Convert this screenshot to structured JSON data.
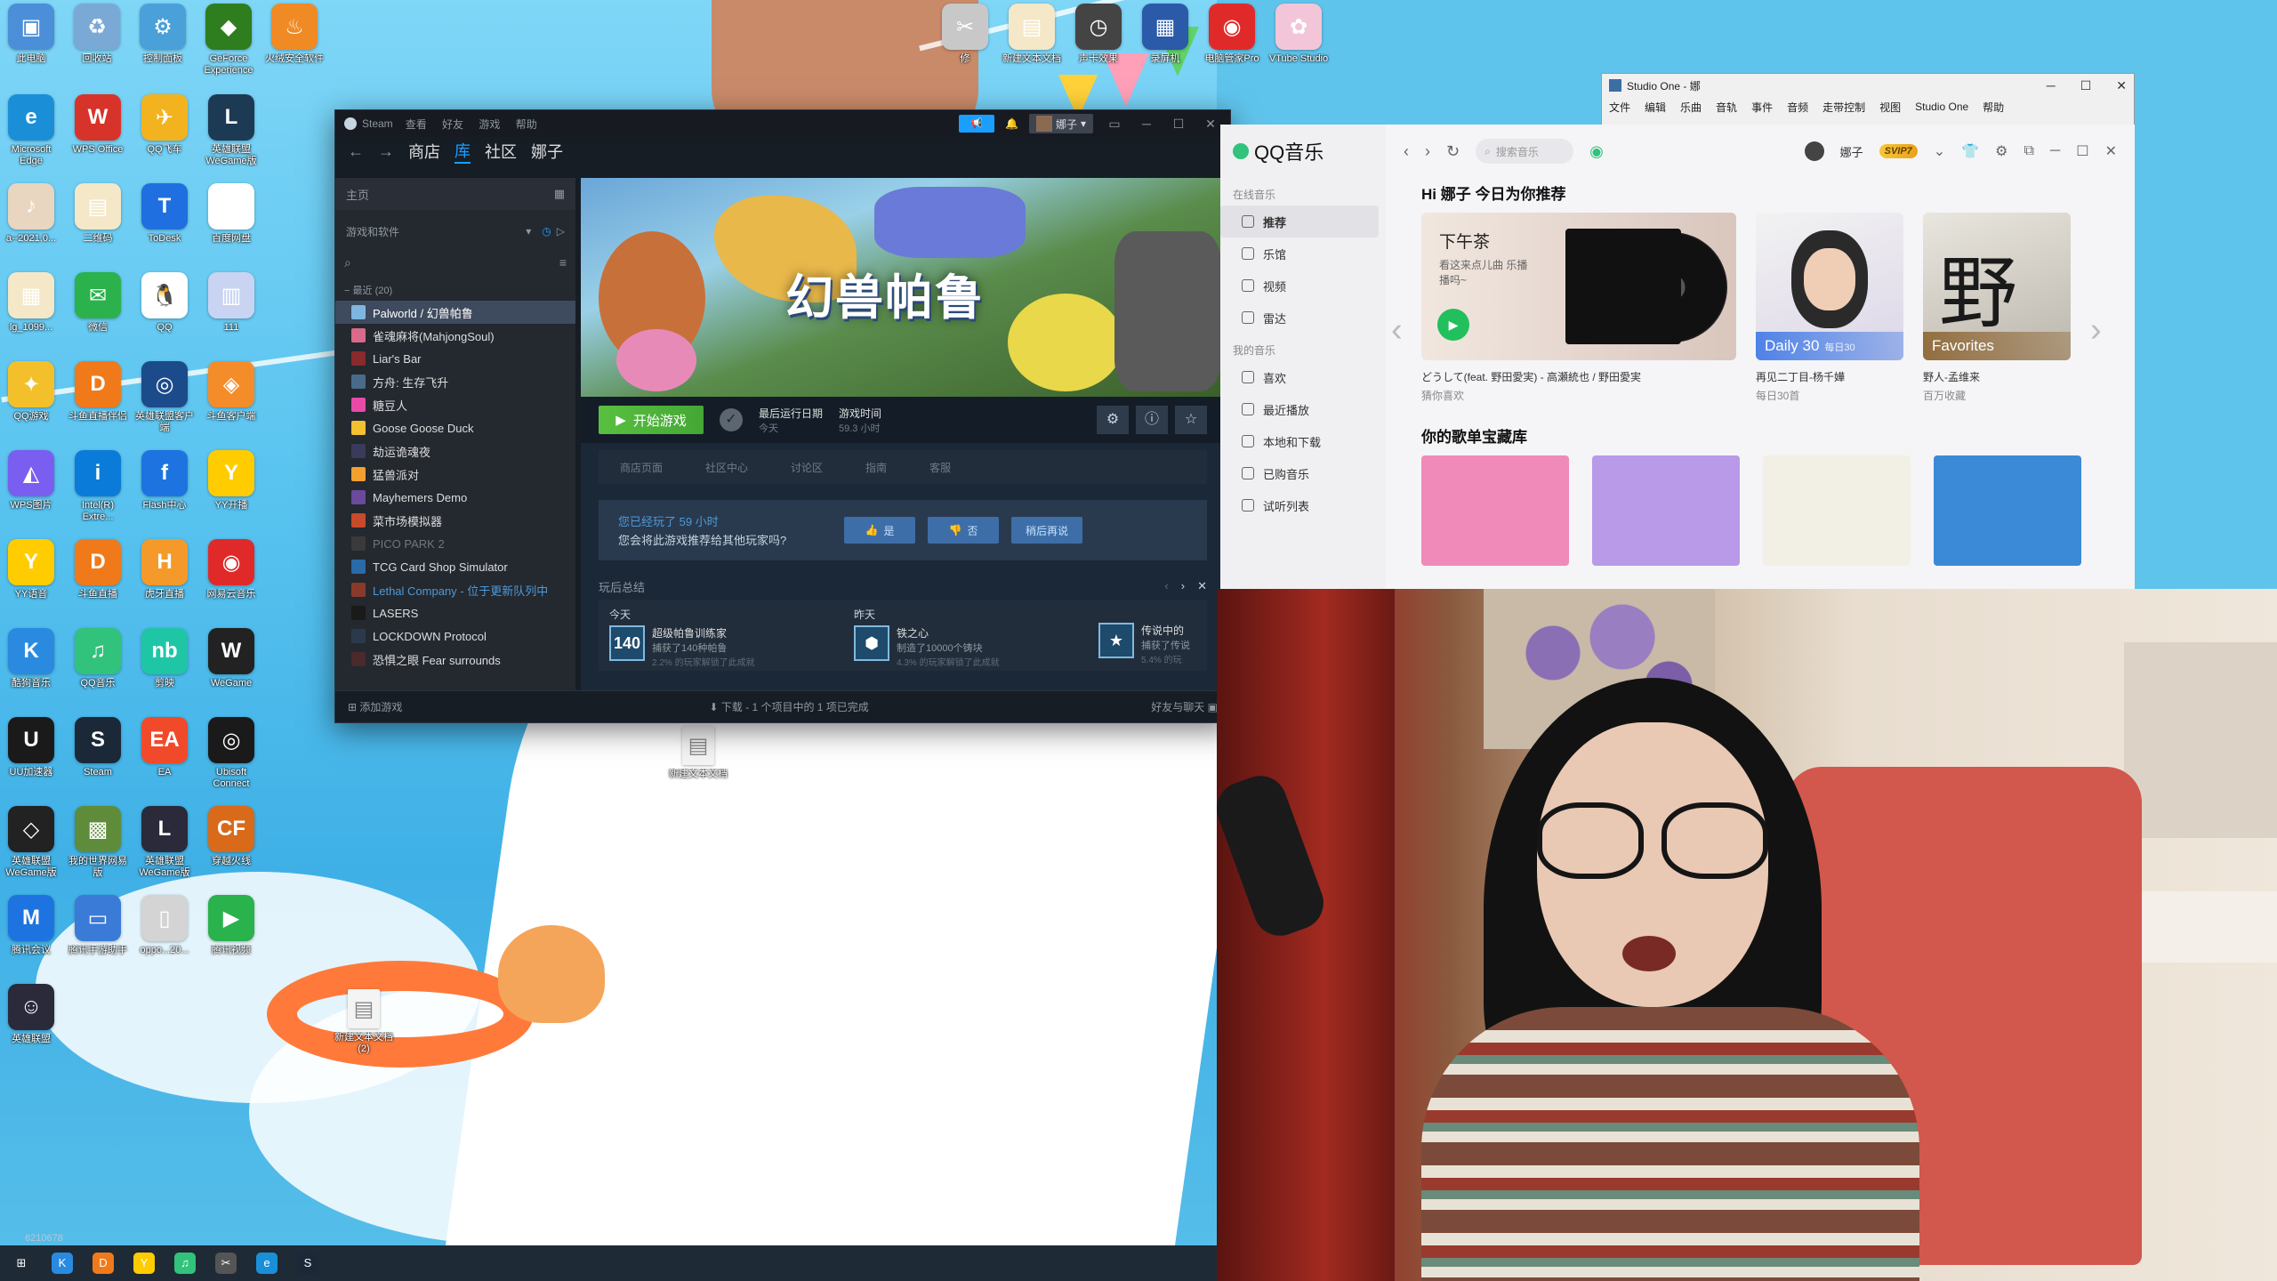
{
  "desktop": {
    "icons": [
      {
        "label": "此电脑",
        "color": "#4a8fd8",
        "glyph": "▣"
      },
      {
        "label": "回收站",
        "color": "#7aa9d6",
        "glyph": "♻"
      },
      {
        "label": "控制面板",
        "color": "#4aa0d8",
        "glyph": "⚙"
      },
      {
        "label": "GeForce Experience",
        "color": "#2e7d1e",
        "glyph": "◆"
      },
      {
        "label": "火绒安全软件",
        "color": "#f08a24",
        "glyph": "♨"
      },
      {
        "label": "Microsoft Edge",
        "color": "#1a8fd8",
        "glyph": "e"
      },
      {
        "label": "WPS Office",
        "color": "#d8332a",
        "glyph": "W"
      },
      {
        "label": "QQ飞车",
        "color": "#f2b31f",
        "glyph": "✈"
      },
      {
        "label": "英雄联盟WeGame版",
        "color": "#1d3a55",
        "glyph": "L"
      },
      {
        "label": "a--2021.0...",
        "color": "#e8d6c0",
        "glyph": "♪"
      },
      {
        "label": "二维码",
        "color": "#f4e8c8",
        "glyph": "▤"
      },
      {
        "label": "ToDesk",
        "color": "#1f6fe0",
        "glyph": "T"
      },
      {
        "label": "百度网盘",
        "color": "#ffffff",
        "glyph": "☁"
      },
      {
        "label": "lg_1099...",
        "color": "#f4e8c8",
        "glyph": "▦"
      },
      {
        "label": "微信",
        "color": "#2bb24c",
        "glyph": "✉"
      },
      {
        "label": "QQ",
        "color": "#ffffff",
        "glyph": "🐧"
      },
      {
        "label": "111",
        "color": "#c9d4f2",
        "glyph": "▥"
      },
      {
        "label": "QQ游戏",
        "color": "#f3c02c",
        "glyph": "✦"
      },
      {
        "label": "斗鱼直播伴侣",
        "color": "#f07a1a",
        "glyph": "D"
      },
      {
        "label": "英雄联盟客户端",
        "color": "#1b4b8a",
        "glyph": "◎"
      },
      {
        "label": "斗鱼客户端",
        "color": "#f48c2a",
        "glyph": "◈"
      },
      {
        "label": "WPS图片",
        "color": "#7a5ef0",
        "glyph": "◭"
      },
      {
        "label": "Intel(R) Extre...",
        "color": "#0a7bd8",
        "glyph": "i"
      },
      {
        "label": "Flash中心",
        "color": "#1d74e0",
        "glyph": "f"
      },
      {
        "label": "YY开播",
        "color": "#ffcc00",
        "glyph": "Y"
      },
      {
        "label": "YY语音",
        "color": "#ffcc00",
        "glyph": "Y"
      },
      {
        "label": "斗鱼直播",
        "color": "#f07a1a",
        "glyph": "D"
      },
      {
        "label": "虎牙直播",
        "color": "#f59a2a",
        "glyph": "H"
      },
      {
        "label": "网易云音乐",
        "color": "#e02a2a",
        "glyph": "◉"
      },
      {
        "label": "酷狗音乐",
        "color": "#2a8ae0",
        "glyph": "K"
      },
      {
        "label": "QQ音乐",
        "color": "#31c27c",
        "glyph": "♫"
      },
      {
        "label": "剪映",
        "color": "#1fc6a6",
        "glyph": "nb"
      },
      {
        "label": "WeGame",
        "color": "#222",
        "glyph": "W"
      },
      {
        "label": "UU加速器",
        "color": "#1a1a1a",
        "glyph": "U"
      },
      {
        "label": "Steam",
        "color": "#1b2838",
        "glyph": "S"
      },
      {
        "label": "EA",
        "color": "#f14a2a",
        "glyph": "EA"
      },
      {
        "label": "Ubisoft Connect",
        "color": "#1a1a1a",
        "glyph": "◎"
      },
      {
        "label": "英雄联盟WeGame版",
        "color": "#222",
        "glyph": "◇"
      },
      {
        "label": "我的世界网易版",
        "color": "#5e8c3a",
        "glyph": "▩"
      },
      {
        "label": "英雄联盟WeGame版",
        "color": "#2a2a3a",
        "glyph": "L"
      },
      {
        "label": "穿越火线",
        "color": "#d86a1a",
        "glyph": "CF"
      },
      {
        "label": "腾讯会议",
        "color": "#1d74e0",
        "glyph": "M"
      },
      {
        "label": "腾讯手游助手",
        "color": "#3b7bd8",
        "glyph": "▭"
      },
      {
        "label": "oppo...20...",
        "color": "#d4d4d4",
        "glyph": "▯"
      },
      {
        "label": "腾讯视频",
        "color": "#2ab24c",
        "glyph": "▶"
      },
      {
        "label": "英雄联盟",
        "color": "#2a2a3a",
        "glyph": "☺"
      }
    ],
    "top_icons": [
      {
        "label": "修",
        "color": "#c8c8c8",
        "glyph": "✂"
      },
      {
        "label": "新建文本文档",
        "color": "#f4e8c8",
        "glyph": "▤"
      },
      {
        "label": "声卡效果",
        "color": "#444",
        "glyph": "◷"
      },
      {
        "label": "录屏机",
        "color": "#2a5aa8",
        "glyph": "▦"
      },
      {
        "label": "电脑管家Pro",
        "color": "#e02a2a",
        "glyph": "◉"
      },
      {
        "label": "VTube Studio",
        "color": "#f2c6d8",
        "glyph": "✿"
      }
    ],
    "floating_files": [
      {
        "label": "新建文本文档"
      },
      {
        "label": "新建文本文档(2)"
      }
    ]
  },
  "steam": {
    "app": "Steam",
    "menu": [
      "查看",
      "好友",
      "游戏",
      "帮助"
    ],
    "announce_btn": "📢",
    "bell": "🔔",
    "user": "娜子",
    "nav": {
      "store": "商店",
      "library": "库",
      "community": "社区",
      "profile": "娜子"
    },
    "sidebar": {
      "home": "主页",
      "filter": "游戏和软件",
      "section": "最近",
      "section_count": "(20)",
      "games": [
        {
          "name": "Palworld / 幻兽帕鲁",
          "state": "selected",
          "color": "#7fb6e0"
        },
        {
          "name": "雀魂麻将(MahjongSoul)",
          "state": "",
          "color": "#d86a8a"
        },
        {
          "name": "Liar's Bar",
          "state": "",
          "color": "#8a2a2a"
        },
        {
          "name": "方舟: 生存飞升",
          "state": "",
          "color": "#4a6a8a"
        },
        {
          "name": "糖豆人",
          "state": "",
          "color": "#e84aa8"
        },
        {
          "name": "Goose Goose Duck",
          "state": "",
          "color": "#f2c030"
        },
        {
          "name": "劫运诡魂夜",
          "state": "",
          "color": "#3a3a5a"
        },
        {
          "name": "猛兽派对",
          "state": "",
          "color": "#f2a030"
        },
        {
          "name": "Mayhemers Demo",
          "state": "",
          "color": "#6a4a9a"
        },
        {
          "name": "菜市场模拟器",
          "state": "",
          "color": "#c84a2a"
        },
        {
          "name": "PICO PARK 2",
          "state": "dim",
          "color": "#3a3a3a"
        },
        {
          "name": "TCG Card Shop Simulator",
          "state": "",
          "color": "#2a6aa8"
        },
        {
          "name": "Lethal Company - 位于更新队列中",
          "state": "update",
          "color": "#8a3a2a"
        },
        {
          "name": "LASERS",
          "state": "",
          "color": "#1a1a1a"
        },
        {
          "name": "LOCKDOWN Protocol",
          "state": "",
          "color": "#2a3a4a"
        },
        {
          "name": "恐惧之眼 Fear surrounds",
          "state": "",
          "color": "#4a2a2a"
        }
      ]
    },
    "game": {
      "hero_title": "幻兽帕鲁",
      "play": "开始游戏",
      "last_played_label": "最后运行日期",
      "last_played_value": "今天",
      "playtime_label": "游戏时间",
      "playtime_value": "59.3 小时",
      "subnav": [
        "商店页面",
        "社区中心",
        "讨论区",
        "指南",
        "客服"
      ],
      "review_played": "您已经玩了 59 小时",
      "review_question": "您会将此游戏推荐给其他玩家吗?",
      "review_yes": "是",
      "review_no": "否",
      "review_later": "稍后再说",
      "recap_title": "玩后总结",
      "recap": [
        {
          "day": "今天",
          "badge": "140",
          "name": "超级帕鲁训练家",
          "desc": "捕获了140种帕鲁",
          "pct": "2.2% 的玩家解锁了此成就"
        },
        {
          "day": "昨天",
          "badge": "⬢",
          "name": "铁之心",
          "desc": "制造了10000个铸块",
          "pct": "4.3% 的玩家解锁了此成就"
        },
        {
          "day": "",
          "badge": "★",
          "name": "传说中的",
          "desc": "捕获了传说",
          "pct": "5.4% 的玩"
        }
      ]
    },
    "status": {
      "add_game": "添加游戏",
      "download": "下载 - 1 个项目中的 1 项已完成",
      "friends": "好友与聊天"
    }
  },
  "studio_one": {
    "title": "Studio One - 娜",
    "menu": [
      "文件",
      "编辑",
      "乐曲",
      "音轨",
      "事件",
      "音频",
      "走带控制",
      "视图",
      "Studio One",
      "帮助"
    ]
  },
  "qqmusic": {
    "brand": "QQ音乐",
    "search_placeholder": "搜索音乐",
    "user": "娜子",
    "vip": "SVIP7",
    "sidebar": {
      "section1": "在线音乐",
      "online": [
        {
          "label": "推荐",
          "active": true
        },
        {
          "label": "乐馆",
          "active": false
        },
        {
          "label": "视频",
          "active": false
        },
        {
          "label": "雷达",
          "active": false
        }
      ],
      "section2": "我的音乐",
      "mine": [
        "喜欢",
        "最近播放",
        "本地和下载",
        "已购音乐",
        "试听列表"
      ]
    },
    "recommend_title": "Hi 娜子 今日为你推荐",
    "tea": {
      "title": "下午茶",
      "subtitle": "看这来点儿曲 乐播播吗~",
      "caption": "どうして(feat. 野田愛実) - 高瀬統也 / 野田愛実",
      "meta": "猜你喜欢"
    },
    "daily": {
      "tag": "Daily 30",
      "tag_sub": "每日30",
      "caption": "再见二丁目-杨千嬅",
      "meta": "每日30首"
    },
    "fav": {
      "tag": "Favorites",
      "caption": "野人-孟维来",
      "meta": "百万收藏"
    },
    "library_title": "你的歌单宝藏库",
    "library_colors": [
      "#f08ab8",
      "#b89ae8",
      "#f2efe4",
      "#3a8ad8"
    ]
  },
  "taskbar": {
    "clock": "6210678",
    "items": [
      {
        "glyph": "⊞",
        "color": "#1e2a36"
      },
      {
        "glyph": "K",
        "color": "#2a8ae0"
      },
      {
        "glyph": "D",
        "color": "#f07a1a"
      },
      {
        "glyph": "Y",
        "color": "#ffcc00"
      },
      {
        "glyph": "♫",
        "color": "#31c27c"
      },
      {
        "glyph": "✂",
        "color": "#555"
      },
      {
        "glyph": "e",
        "color": "#1a8fd8"
      },
      {
        "glyph": "S",
        "color": "#1b2838"
      }
    ]
  }
}
